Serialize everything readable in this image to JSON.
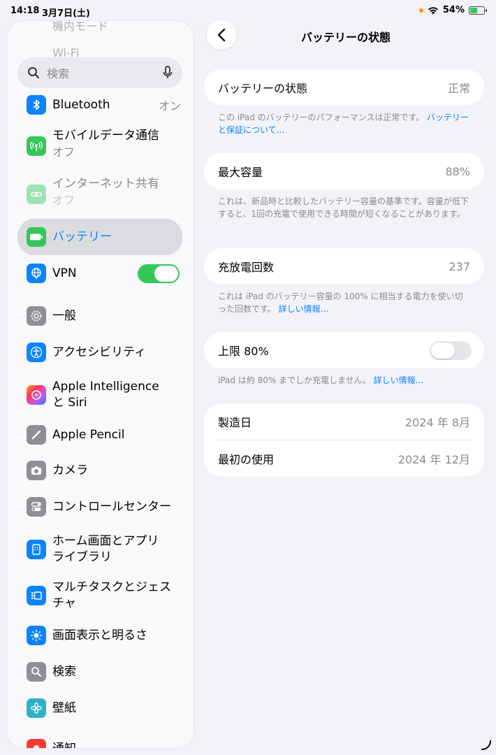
{
  "status_bar": {
    "time": "14:18",
    "date": "3月7日(土)",
    "battery_text": "54%",
    "battery_level": 0.54
  },
  "sidebar": {
    "faded_top": "機内モード",
    "faded_wifi": "Wi-Fi",
    "search_placeholder": "検索",
    "items": [
      {
        "label": "Bluetooth",
        "value": "オン",
        "color": "#0a84ff",
        "icon": "bluetooth-icon"
      },
      {
        "label": "モバイルデータ通信",
        "sub": "オフ",
        "color": "#34c759",
        "icon": "antenna-icon"
      },
      {
        "label": "インターネット共有",
        "sub": "オフ",
        "color": "#34c759",
        "icon": "link-icon"
      },
      {
        "label": "バッテリー",
        "color": "#34c759",
        "icon": "battery-icon"
      },
      {
        "label": "VPN",
        "color": "#0a84ff",
        "icon": "globe-icon"
      },
      {
        "label": "一般",
        "color": "#8e8e93",
        "icon": "gear-icon"
      },
      {
        "label": "アクセシビリティ",
        "color": "#0a84ff",
        "icon": "accessibility-icon"
      },
      {
        "label": "Apple Intelligence",
        "label2": "と Siri",
        "color": "#ff6482",
        "icon": "apple-intelligence-icon"
      },
      {
        "label": "Apple Pencil",
        "color": "#8e8e93",
        "icon": "pencil-icon"
      },
      {
        "label": "カメラ",
        "color": "#8e8e93",
        "icon": "camera-icon"
      },
      {
        "label": "コントロールセンター",
        "color": "#8e8e93",
        "icon": "toggles-icon"
      },
      {
        "label": "ホーム画面とアプリ",
        "label2": "ライブラリ",
        "color": "#0a84ff",
        "icon": "home-screen-icon"
      },
      {
        "label": "マルチタスクとジェス",
        "label2": "チャ",
        "color": "#0a84ff",
        "icon": "multitask-icon"
      },
      {
        "label": "画面表示と明るさ",
        "color": "#0a84ff",
        "icon": "sun-icon"
      },
      {
        "label": "検索",
        "color": "#8e8e93",
        "icon": "search-icon"
      },
      {
        "label": "壁紙",
        "color": "#30b0c7",
        "icon": "flower-icon"
      },
      {
        "label": "通知",
        "color": "#ff3b30",
        "icon": "bell-icon"
      }
    ]
  },
  "main": {
    "title": "バッテリーの状態",
    "health": {
      "label": "バッテリーの状態",
      "value": "正常"
    },
    "health_note": "この iPad のバッテリーのパフォーマンスは正常です。",
    "health_note_link": "バッテリーと保証について...",
    "max_capacity": {
      "label": "最大容量",
      "value": "88%"
    },
    "max_capacity_note": "これは、新品時と比較したバッテリー容量の基準です。容量が低下すると、1回の充電で使用できる時間が短くなることがあります。",
    "cycle_count": {
      "label": "充放電回数",
      "value": "237"
    },
    "cycle_note": "これは iPad のバッテリー容量の 100% に相当する電力を使い切った回数です。",
    "cycle_note_link": "詳しい情報...",
    "limit": {
      "label": "上限 80%",
      "enabled": false
    },
    "limit_note": "iPad は約 80% までしか充電しません。",
    "limit_note_link": "詳しい情報...",
    "manufacture": {
      "label": "製造日",
      "value": "2024 年 8月"
    },
    "first_use": {
      "label": "最初の使用",
      "value": "2024 年 12月"
    }
  }
}
